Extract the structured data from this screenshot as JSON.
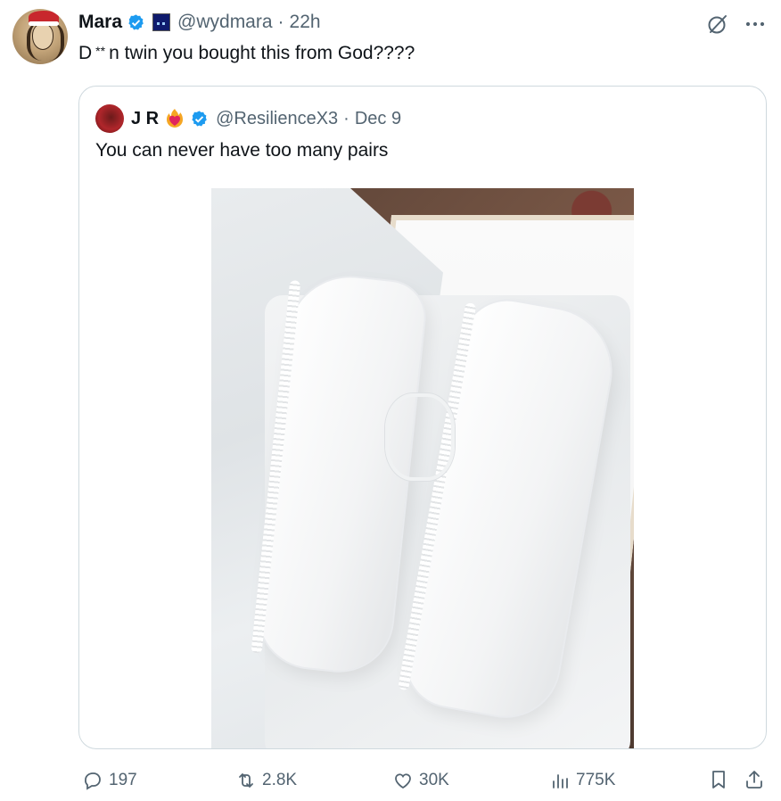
{
  "tweet": {
    "author_name": "Mara",
    "handle": "@wydmara",
    "separator": "·",
    "time": "22h",
    "text_prefix": "D",
    "text_stars": "**",
    "text_rest": "n twin you bought this from God????"
  },
  "quote": {
    "author_name": "J R",
    "handle": "@ResilienceX3",
    "separator": "·",
    "date": "Dec 9",
    "text": "You can never have too many pairs"
  },
  "actions": {
    "replies": "197",
    "reposts": "2.8K",
    "likes": "30K",
    "views": "775K"
  },
  "colors": {
    "text": "#0f1419",
    "muted": "#536471",
    "verified": "#1d9bf0",
    "border": "#cfd9de"
  }
}
